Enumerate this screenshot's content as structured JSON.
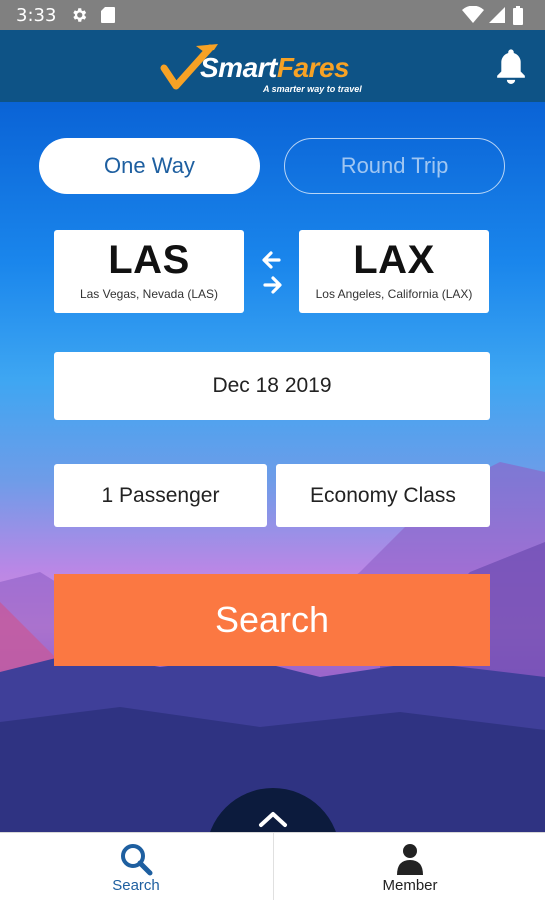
{
  "status_bar": {
    "time": "3:33",
    "icons": [
      "gear-icon",
      "sd-card-icon",
      "wifi-icon",
      "cellular-signal-icon",
      "battery-icon"
    ]
  },
  "header": {
    "brand_part1": "Smart",
    "brand_part2": "Fares",
    "tagline": "A smarter way to travel",
    "notification_icon": "bell-icon",
    "colors": {
      "background": "#0e5386",
      "accent": "#f7a225"
    }
  },
  "trip_type": {
    "options": [
      "One Way",
      "Round Trip"
    ],
    "selected": "One Way"
  },
  "origin": {
    "code": "LAS",
    "name": "Las Vegas, Nevada (LAS)"
  },
  "destination": {
    "code": "LAX",
    "name": "Los Angeles, California (LAX)"
  },
  "swap_icon": "swap-arrows-icon",
  "date": "Dec 18 2019",
  "passengers": "1 Passenger",
  "cabin_class": "Economy Class",
  "search_button": {
    "label": "Search",
    "color": "#fb7842"
  },
  "expand_icon": "chevron-up-icon",
  "bottom_nav": {
    "items": [
      {
        "label": "Search",
        "icon": "search-icon",
        "active": true
      },
      {
        "label": "Member",
        "icon": "person-icon",
        "active": false
      }
    ],
    "active_color": "#1e5fa0"
  }
}
